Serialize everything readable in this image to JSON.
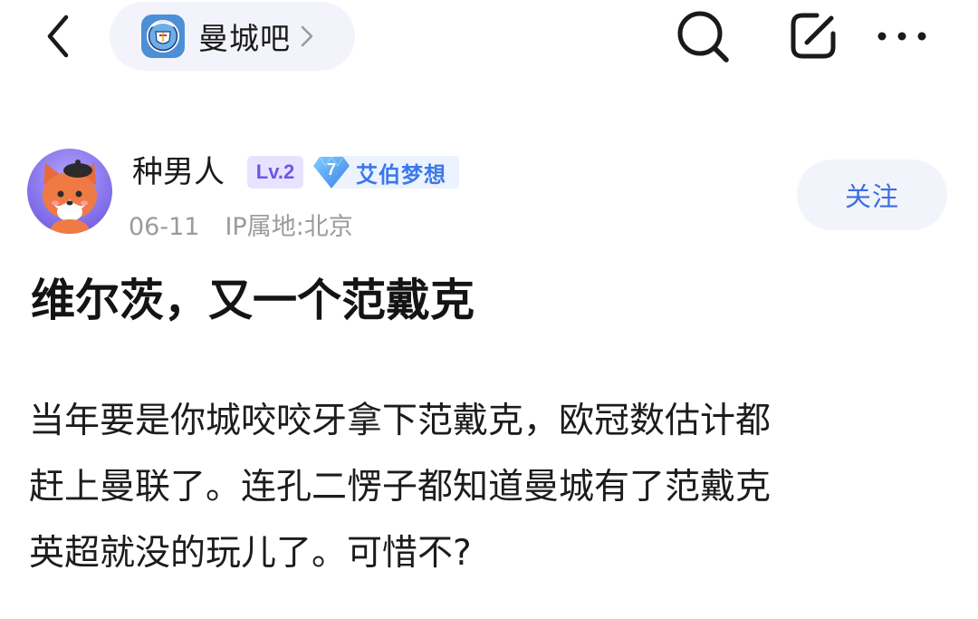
{
  "header": {
    "forum_name": "曼城吧",
    "icons": {
      "back": "back-chevron-icon",
      "forum_logo": "man-city-crest-icon",
      "forum_chevron": "chevron-right-icon",
      "search": "search-icon",
      "edit": "edit-icon",
      "more": "more-icon"
    }
  },
  "author": {
    "name": "种男人",
    "avatar": "fox-avatar",
    "level": "Lv.2",
    "member_rank": "7",
    "member_title": "艾伯梦想",
    "date": "06-11",
    "ip_location": "IP属地:北京",
    "follow_label": "关注"
  },
  "post": {
    "title": "维尔茨，又一个范戴克",
    "body_lines": [
      "当年要是你城咬咬牙拿下范戴克，欧冠数估计都",
      "赶上曼联了。连孔二愣子都知道曼城有了范戴克",
      "英超就没的玩儿了。可惜不?"
    ]
  },
  "colors": {
    "accent_blue": "#3b6de1",
    "level_purple": "#6d56e8",
    "pill_bg": "#f3f4fb",
    "meta_gray": "#9b9b9b"
  }
}
